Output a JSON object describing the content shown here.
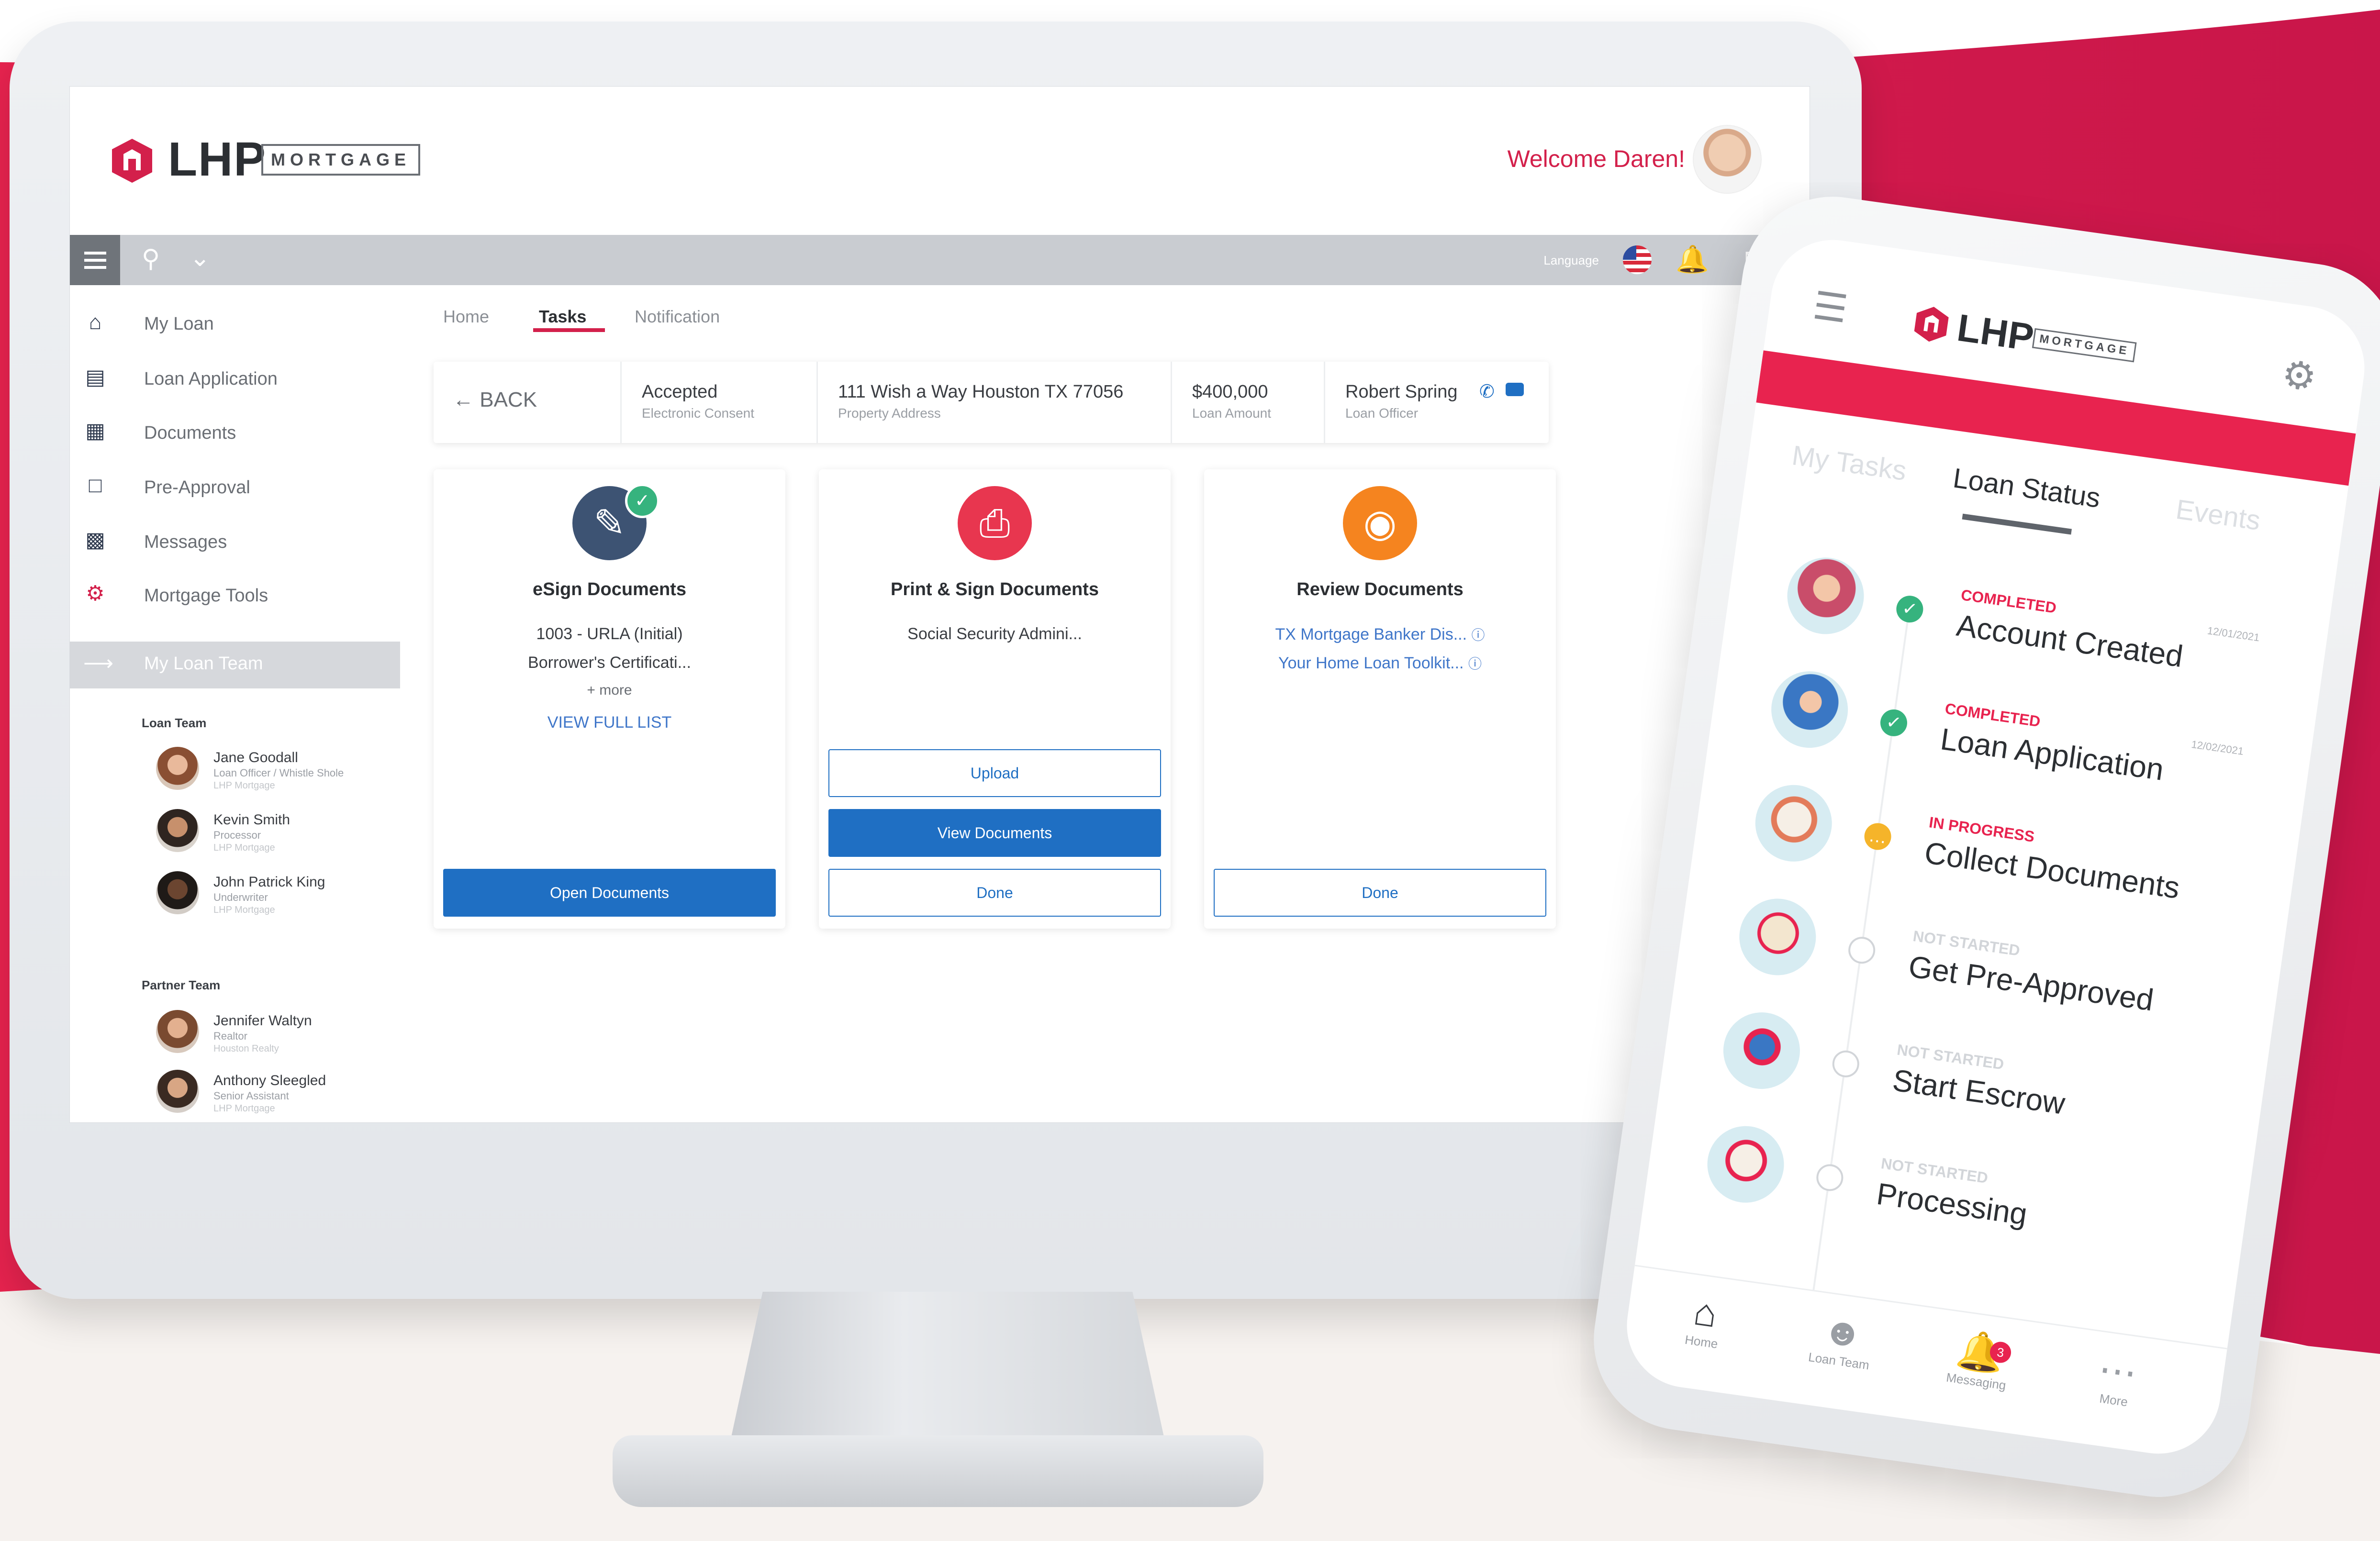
{
  "colors": {
    "brand_red": "#d3204b",
    "brand_blue": "#1f6fc3",
    "completed_green": "#36b37e",
    "in_progress_yellow": "#f5b42a"
  },
  "desktop": {
    "logo": {
      "text": "LHP",
      "badge": "MORTGAGE"
    },
    "welcome": "Welcome Daren!",
    "toolbar": {
      "language_label": "Language",
      "icons": [
        "menu-icon",
        "search-icon",
        "chevron-down-icon",
        "flag-icon",
        "bell-icon",
        "chat-icon"
      ]
    },
    "nav": [
      {
        "label": "My Loan",
        "icon": "home-icon"
      },
      {
        "label": "Loan Application",
        "icon": "clipboard-icon"
      },
      {
        "label": "Documents",
        "icon": "documents-icon"
      },
      {
        "label": "Pre-Approval",
        "icon": "file-icon"
      },
      {
        "label": "Messages",
        "icon": "messages-icon"
      },
      {
        "label": "Mortgage Tools",
        "icon": "tools-icon"
      },
      {
        "label": "My Loan Team",
        "icon": "share-icon"
      }
    ],
    "loan_team": {
      "title": "Loan Team",
      "members": [
        {
          "name": "Jane Goodall",
          "role": "Loan Officer / Whistle Shole",
          "company": "LHP Mortgage"
        },
        {
          "name": "Kevin Smith",
          "role": "Processor",
          "company": "LHP Mortgage"
        },
        {
          "name": "John Patrick King",
          "role": "Underwriter",
          "company": "LHP Mortgage"
        }
      ]
    },
    "partner_team": {
      "title": "Partner Team",
      "members": [
        {
          "name": "Jennifer Waltyn",
          "role": "Realtor",
          "company": "Houston Realty"
        },
        {
          "name": "Anthony Sleegled",
          "role": "Senior Assistant",
          "company": "LHP Mortgage"
        }
      ]
    },
    "tabs": [
      "Home",
      "Tasks",
      "Notification"
    ],
    "info_bar": {
      "back": "BACK",
      "cells": [
        {
          "value": "Accepted",
          "label": "Electronic Consent"
        },
        {
          "value": "111 Wish a Way Houston TX 77056",
          "label": "Property Address"
        },
        {
          "value": "$400,000",
          "label": "Loan Amount"
        },
        {
          "value": "Robert Spring",
          "label": "Loan Officer"
        }
      ]
    },
    "cards": [
      {
        "title": "eSign Documents",
        "icon": "pen-icon",
        "lines": [
          "1003 - URLA (Initial)",
          "Borrower's Certificati...",
          "+ more"
        ],
        "link": "VIEW FULL LIST",
        "button": "Open Documents"
      },
      {
        "title": "Print & Sign Documents",
        "icon": "printer-icon",
        "lines": [
          "Social Security Admini..."
        ],
        "buttons": [
          "Upload",
          "View Documents",
          "Done"
        ]
      },
      {
        "title": "Review Documents",
        "icon": "eye-icon",
        "links": [
          "TX Mortgage Banker Dis...",
          "Your Home Loan Toolkit..."
        ],
        "button": "Done"
      }
    ]
  },
  "mobile": {
    "logo": {
      "text": "LHP",
      "badge": "MORTGAGE"
    },
    "tabs": [
      "My Tasks",
      "Loan Status",
      "Events"
    ],
    "active_tab": "Loan Status",
    "steps": [
      {
        "status": "COMPLETED",
        "name": "Account Created",
        "date": "12/01/2021",
        "state": "completed"
      },
      {
        "status": "COMPLETED",
        "name": "Loan Application",
        "date": "12/02/2021",
        "state": "completed"
      },
      {
        "status": "IN PROGRESS",
        "name": "Collect Documents",
        "date": "",
        "state": "in-progress"
      },
      {
        "status": "NOT STARTED",
        "name": "Get Pre-Approved",
        "date": "",
        "state": "not-started"
      },
      {
        "status": "NOT STARTED",
        "name": "Start Escrow",
        "date": "",
        "state": "not-started"
      },
      {
        "status": "NOT STARTED",
        "name": "Processing",
        "date": "",
        "state": "not-started"
      }
    ],
    "bottom_nav": [
      {
        "label": "Home",
        "icon": "home-icon"
      },
      {
        "label": "Loan Team",
        "icon": "team-icon"
      },
      {
        "label": "Messaging",
        "icon": "bell-icon",
        "badge": "3"
      },
      {
        "label": "More",
        "icon": "more-icon"
      }
    ]
  }
}
